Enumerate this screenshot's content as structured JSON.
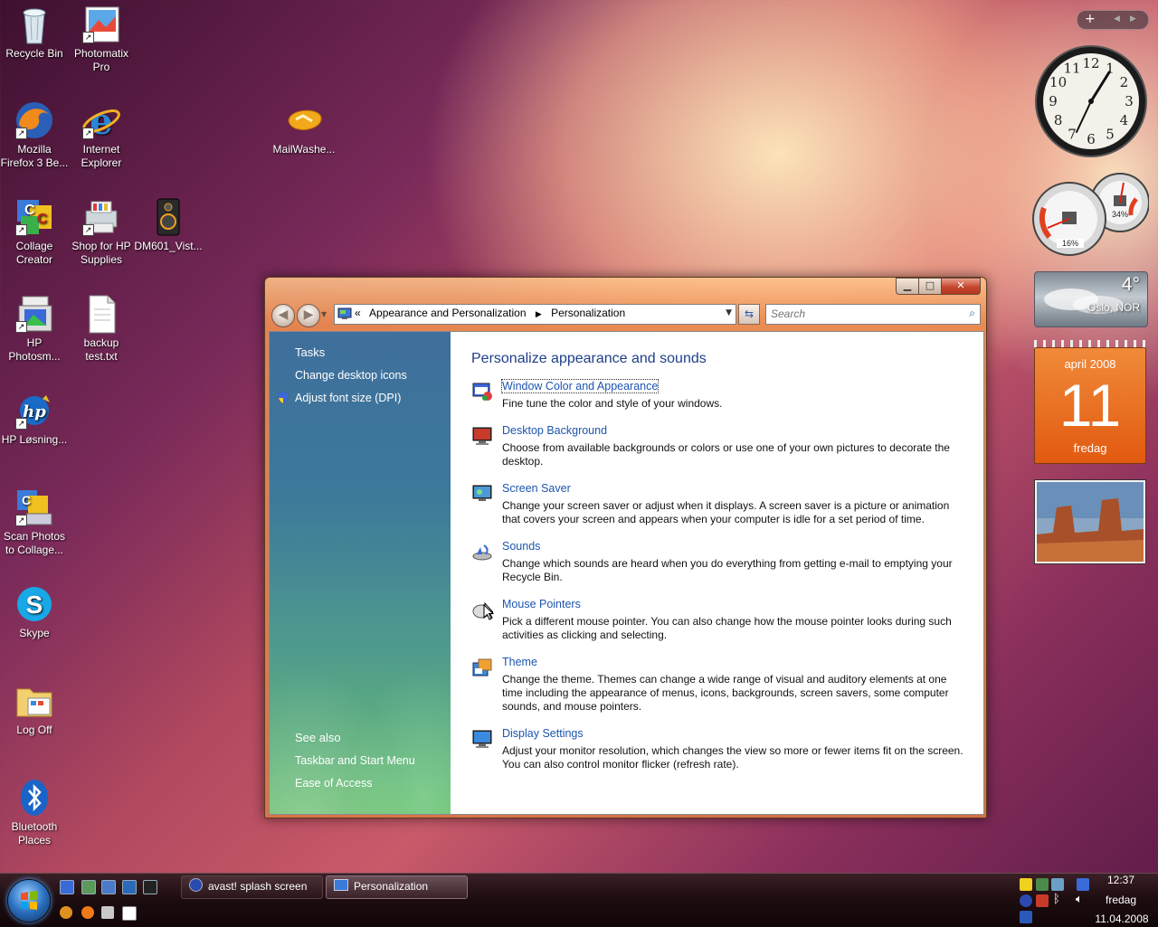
{
  "desktop": {
    "icons": [
      {
        "label": "Recycle Bin"
      },
      {
        "label": "Photomatix Pro"
      },
      {
        "label": "Mozilla Firefox 3 Be..."
      },
      {
        "label": "Internet Explorer"
      },
      {
        "label": "MailWashe..."
      },
      {
        "label": "Collage Creator"
      },
      {
        "label": "Shop for HP Supplies"
      },
      {
        "label": "DM601_Vist..."
      },
      {
        "label": "HP Photosm..."
      },
      {
        "label": "backup test.txt"
      },
      {
        "label": "HP Løsning..."
      },
      {
        "label": "Scan Photos to Collage..."
      },
      {
        "label": "Skype"
      },
      {
        "label": "Log Off"
      },
      {
        "label": "Bluetooth Places"
      }
    ]
  },
  "gadgets": {
    "cpu_percent": "16%",
    "mem_percent": "34%",
    "weather": {
      "temp": "4°",
      "city": "Oslo, NOR"
    },
    "calendar": {
      "month": "april 2008",
      "day": "11",
      "weekday": "fredag"
    },
    "clock": {
      "numbers": [
        "12",
        "1",
        "2",
        "3",
        "4",
        "5",
        "6",
        "7",
        "8",
        "9",
        "10",
        "11"
      ]
    }
  },
  "window": {
    "breadcrumb": {
      "prefix": "«",
      "level1": "Appearance and Personalization",
      "level2": "Personalization"
    },
    "search_placeholder": "Search",
    "sidebar": {
      "tasks_heading": "Tasks",
      "tasks": [
        "Change desktop icons",
        "Adjust font size (DPI)"
      ],
      "see_also_heading": "See also",
      "see_also": [
        "Taskbar and Start Menu",
        "Ease of Access"
      ]
    },
    "main": {
      "title": "Personalize appearance and sounds",
      "items": [
        {
          "link": "Window Color and Appearance",
          "desc": "Fine tune the color and style of your windows."
        },
        {
          "link": "Desktop Background",
          "desc": "Choose from available backgrounds or colors or use one of your own pictures to decorate the desktop."
        },
        {
          "link": "Screen Saver",
          "desc": "Change your screen saver or adjust when it displays. A screen saver is a picture or animation that covers your screen and appears when your computer is idle for a set period of time."
        },
        {
          "link": "Sounds",
          "desc": "Change which sounds are heard when you do everything from getting e-mail to emptying your Recycle Bin."
        },
        {
          "link": "Mouse Pointers",
          "desc": "Pick a different mouse pointer. You can also change how the mouse pointer looks during such activities as clicking and selecting."
        },
        {
          "link": "Theme",
          "desc": "Change the theme. Themes can change a wide range of visual and auditory elements at one time including the appearance of menus, icons, backgrounds, screen savers, some computer sounds, and mouse pointers."
        },
        {
          "link": "Display Settings",
          "desc": "Adjust your monitor resolution, which changes the view so more or fewer items fit on the screen. You can also control monitor flicker (refresh rate)."
        }
      ]
    }
  },
  "taskbar": {
    "buttons": [
      {
        "label": "avast! splash screen"
      },
      {
        "label": "Personalization"
      }
    ],
    "clock": {
      "time": "12:37",
      "weekday": "fredag",
      "date": "11.04.2008"
    }
  }
}
